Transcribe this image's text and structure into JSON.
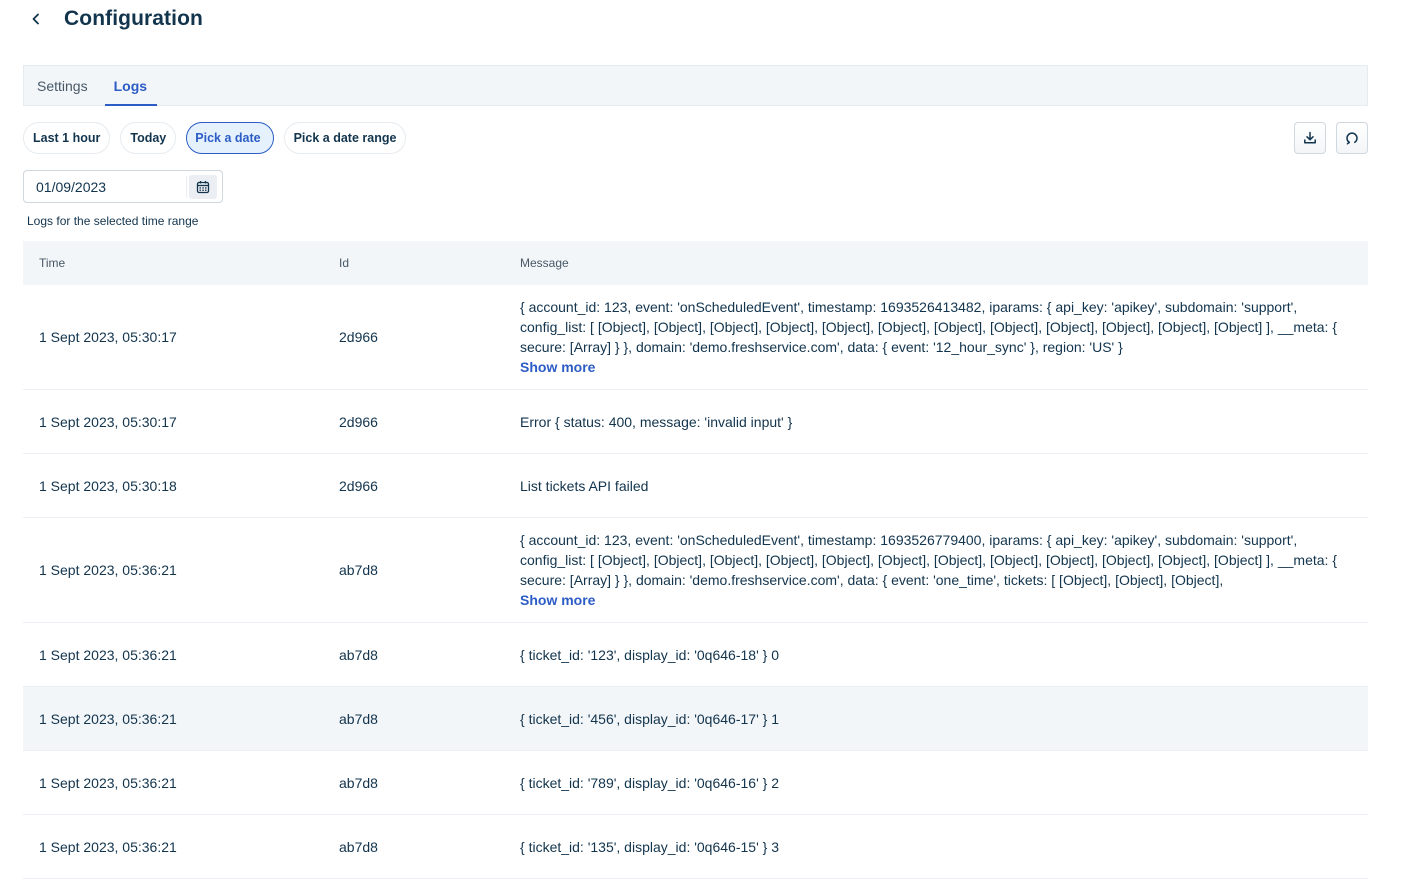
{
  "header": {
    "back_icon": "chevron-left-icon",
    "title": "Configuration"
  },
  "tabs": [
    {
      "label": "Settings",
      "active": false
    },
    {
      "label": "Logs",
      "active": true
    }
  ],
  "filters": {
    "options": [
      {
        "label": "Last 1 hour",
        "active": false
      },
      {
        "label": "Today",
        "active": false
      },
      {
        "label": "Pick a date",
        "active": true
      },
      {
        "label": "Pick a date range",
        "active": false
      }
    ],
    "download_icon": "download-icon",
    "refresh_icon": "refresh-icon"
  },
  "date_picker": {
    "value": "01/09/2023",
    "icon": "calendar-icon"
  },
  "caption": "Logs for the selected time range",
  "table": {
    "columns": [
      "Time",
      "Id",
      "Message"
    ],
    "show_more_label": "Show more",
    "rows": [
      {
        "time": "1 Sept 2023, 05:30:17",
        "id": "2d966",
        "message": "{ account_id: 123, event: 'onScheduledEvent', timestamp: 1693526413482, iparams: { api_key: 'apikey', subdomain: 'support', config_list: [ [Object], [Object], [Object], [Object], [Object], [Object], [Object], [Object], [Object], [Object], [Object], [Object] ], __meta: { secure: [Array] } }, domain: 'demo.freshservice.com', data: { event: '12_hour_sync' }, region: 'US' }",
        "truncated": true
      },
      {
        "time": "1 Sept 2023, 05:30:17",
        "id": "2d966",
        "message": "Error { status: 400, message: 'invalid input' }",
        "truncated": false
      },
      {
        "time": "1 Sept 2023, 05:30:18",
        "id": "2d966",
        "message": "List tickets API failed",
        "truncated": false
      },
      {
        "time": "1 Sept 2023, 05:36:21",
        "id": "ab7d8",
        "message": "{ account_id: 123, event: 'onScheduledEvent', timestamp: 1693526779400, iparams: { api_key: 'apikey', subdomain: 'support', config_list: [ [Object], [Object], [Object], [Object], [Object], [Object], [Object], [Object], [Object], [Object], [Object], [Object] ], __meta: { secure: [Array] } }, domain: 'demo.freshservice.com', data: { event: 'one_time', tickets: [ [Object], [Object], [Object],",
        "truncated": true
      },
      {
        "time": "1 Sept 2023, 05:36:21",
        "id": "ab7d8",
        "message": "{ ticket_id: '123', display_id: '0q646-18' } 0",
        "truncated": false
      },
      {
        "time": "1 Sept 2023, 05:36:21",
        "id": "ab7d8",
        "message": "{ ticket_id: '456', display_id: '0q646-17' } 1",
        "truncated": false,
        "hovered": true
      },
      {
        "time": "1 Sept 2023, 05:36:21",
        "id": "ab7d8",
        "message": "{ ticket_id: '789', display_id: '0q646-16' } 2",
        "truncated": false
      },
      {
        "time": "1 Sept 2023, 05:36:21",
        "id": "ab7d8",
        "message": "{ ticket_id: '135', display_id: '0q646-15' } 3",
        "truncated": false
      }
    ]
  }
}
